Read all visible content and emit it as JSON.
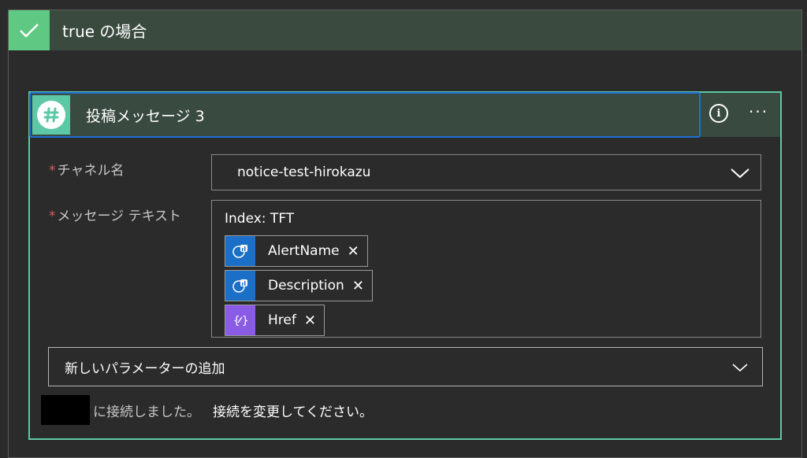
{
  "condition": {
    "title": "true の場合",
    "accent_color": "#5fc883"
  },
  "action": {
    "title": "投稿メッセージ 3",
    "icon": "slack-icon",
    "border_color": "#5ec8a6",
    "info_label": "i",
    "more_label": "···"
  },
  "fields": {
    "channel": {
      "required_mark": "*",
      "label": "チャネル名",
      "value": "notice-test-hirokazu"
    },
    "message": {
      "required_mark": "*",
      "label": "メッセージ テキスト",
      "text": "Index: TFT",
      "tokens": [
        {
          "label": "AlertName",
          "icon": "azure-monitor-icon",
          "color": "#1b6fc7"
        },
        {
          "label": "Description",
          "icon": "azure-monitor-icon",
          "color": "#1b6fc7"
        },
        {
          "label": "Href",
          "icon": "expression-icon",
          "color": "#8a5ce6"
        }
      ],
      "remove_label": "✕"
    }
  },
  "add_parameter": {
    "label": "新しいパラメーターの追加"
  },
  "connection": {
    "connected_text": "に接続しました。",
    "change_text": "接続を変更してください。"
  }
}
